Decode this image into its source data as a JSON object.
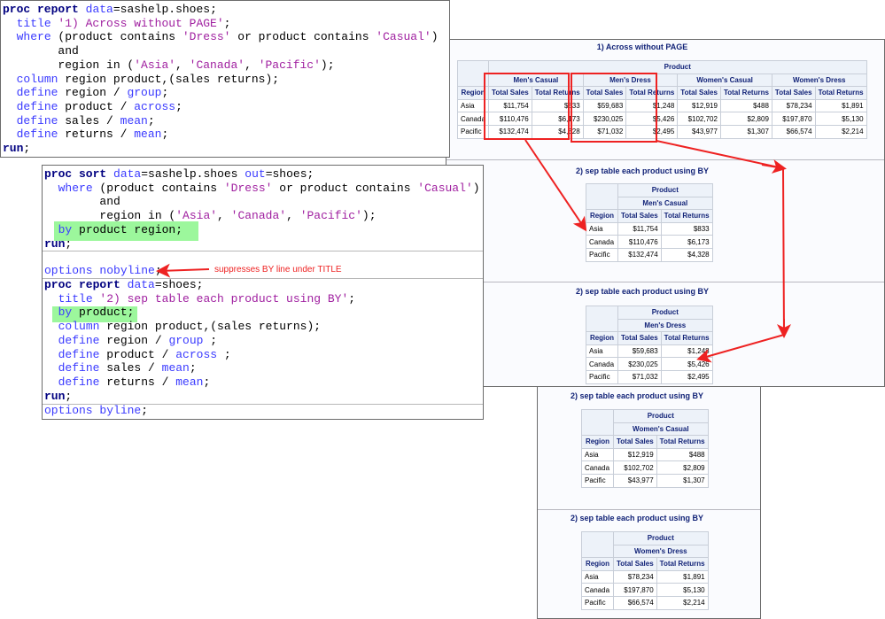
{
  "colors": {
    "keyword": "#000080",
    "statement": "#3a3aff",
    "string": "#a020a0",
    "header_text": "#112277",
    "header_bg": "#edf2f9",
    "annotation": "#ee2222",
    "highlight": "#9cf79c"
  },
  "code1": [
    [
      [
        "proc report",
        "kw"
      ],
      [
        " ",
        ""
      ],
      [
        "data",
        "bl"
      ],
      [
        "=sashelp.shoes;",
        ""
      ]
    ],
    [
      [
        "  ",
        ""
      ],
      [
        "title",
        "bl"
      ],
      [
        " '1) Across without PAGE'",
        "st"
      ],
      [
        ";",
        ""
      ]
    ],
    [
      [
        "  ",
        ""
      ],
      [
        "where",
        "bl"
      ],
      [
        " (product contains ",
        ""
      ],
      [
        "'Dress'",
        "st"
      ],
      [
        " or product contains ",
        ""
      ],
      [
        "'Casual'",
        "st"
      ],
      [
        ")",
        ""
      ]
    ],
    [
      [
        "        and",
        ""
      ]
    ],
    [
      [
        "        region in (",
        ""
      ],
      [
        "'Asia'",
        "st"
      ],
      [
        ", ",
        ""
      ],
      [
        "'Canada'",
        "st"
      ],
      [
        ", ",
        ""
      ],
      [
        "'Pacific'",
        "st"
      ],
      [
        ");",
        ""
      ]
    ],
    [
      [
        "  ",
        ""
      ],
      [
        "column",
        "bl"
      ],
      [
        " region product,(sales returns);",
        ""
      ]
    ],
    [
      [
        "  ",
        ""
      ],
      [
        "define",
        "bl"
      ],
      [
        " region / ",
        ""
      ],
      [
        "group",
        "bl"
      ],
      [
        ";",
        ""
      ]
    ],
    [
      [
        "  ",
        ""
      ],
      [
        "define",
        "bl"
      ],
      [
        " product / ",
        ""
      ],
      [
        "across",
        "bl"
      ],
      [
        ";",
        ""
      ]
    ],
    [
      [
        "  ",
        ""
      ],
      [
        "define",
        "bl"
      ],
      [
        " sales / ",
        ""
      ],
      [
        "mean",
        "bl"
      ],
      [
        ";",
        ""
      ]
    ],
    [
      [
        "  ",
        ""
      ],
      [
        "define",
        "bl"
      ],
      [
        " returns / ",
        ""
      ],
      [
        "mean",
        "bl"
      ],
      [
        ";",
        ""
      ]
    ],
    [
      [
        "run",
        "kw"
      ],
      [
        ";",
        ""
      ]
    ]
  ],
  "code2a": [
    [
      [
        "proc sort",
        "kw"
      ],
      [
        " ",
        ""
      ],
      [
        "data",
        "bl"
      ],
      [
        "=sashelp.shoes ",
        ""
      ],
      [
        "out",
        "bl"
      ],
      [
        "=shoes;",
        ""
      ]
    ],
    [
      [
        "  ",
        ""
      ],
      [
        "where",
        "bl"
      ],
      [
        " (product contains ",
        ""
      ],
      [
        "'Dress'",
        "st"
      ],
      [
        " or product contains ",
        ""
      ],
      [
        "'Casual'",
        "st"
      ],
      [
        ")",
        ""
      ]
    ],
    [
      [
        "        and",
        ""
      ]
    ],
    [
      [
        "        region in (",
        ""
      ],
      [
        "'Asia'",
        "st"
      ],
      [
        ", ",
        ""
      ],
      [
        "'Canada'",
        "st"
      ],
      [
        ", ",
        ""
      ],
      [
        "'Pacific'",
        "st"
      ],
      [
        ");",
        ""
      ]
    ],
    [
      [
        "  ",
        ""
      ],
      [
        "by",
        "bl"
      ],
      [
        " product region;",
        ""
      ]
    ],
    [
      [
        "run",
        "kw"
      ],
      [
        ";",
        ""
      ]
    ]
  ],
  "code2b": [
    [
      [
        "options",
        "bl"
      ],
      [
        " ",
        ""
      ],
      [
        "nobyline",
        "bl"
      ],
      [
        ";",
        ""
      ]
    ]
  ],
  "code2c": [
    [
      [
        "proc report",
        "kw"
      ],
      [
        " ",
        ""
      ],
      [
        "data",
        "bl"
      ],
      [
        "=shoes;",
        ""
      ]
    ],
    [
      [
        "  ",
        ""
      ],
      [
        "title",
        "bl"
      ],
      [
        " '2) sep table each product using BY'",
        "st"
      ],
      [
        ";",
        ""
      ]
    ],
    [
      [
        "  ",
        ""
      ],
      [
        "by",
        "bl"
      ],
      [
        " product;",
        ""
      ]
    ],
    [
      [
        "  ",
        ""
      ],
      [
        "column",
        "bl"
      ],
      [
        " region product,(sales returns);",
        ""
      ]
    ],
    [
      [
        "  ",
        ""
      ],
      [
        "define",
        "bl"
      ],
      [
        " region / ",
        ""
      ],
      [
        "group",
        "bl"
      ],
      [
        " ;",
        ""
      ]
    ],
    [
      [
        "  ",
        ""
      ],
      [
        "define",
        "bl"
      ],
      [
        " product / ",
        ""
      ],
      [
        "across",
        "bl"
      ],
      [
        " ;",
        ""
      ]
    ],
    [
      [
        "  ",
        ""
      ],
      [
        "define",
        "bl"
      ],
      [
        " sales / ",
        ""
      ],
      [
        "mean",
        "bl"
      ],
      [
        ";",
        ""
      ]
    ],
    [
      [
        "  ",
        ""
      ],
      [
        "define",
        "bl"
      ],
      [
        " returns / ",
        ""
      ],
      [
        "mean",
        "bl"
      ],
      [
        ";",
        ""
      ]
    ],
    [
      [
        "run",
        "kw"
      ],
      [
        ";",
        ""
      ]
    ]
  ],
  "code2d": [
    [
      [
        "options",
        "bl"
      ],
      [
        " ",
        ""
      ],
      [
        "byline",
        "bl"
      ],
      [
        ";",
        ""
      ]
    ]
  ],
  "annotation": "suppresses BY line under TITLE",
  "report1": {
    "title": "1) Across without PAGE",
    "product_label": "Product",
    "region_label": "Region",
    "sales_label": "Total Sales",
    "returns_label": "Total Returns",
    "products": [
      "Men's Casual",
      "Men's Dress",
      "Women's Casual",
      "Women's Dress"
    ],
    "rows": [
      {
        "region": "Asia",
        "values": [
          "$11,754",
          "$833",
          "$59,683",
          "$1,248",
          "$12,919",
          "$488",
          "$78,234",
          "$1,891"
        ]
      },
      {
        "region": "Canada",
        "values": [
          "$110,476",
          "$6,173",
          "$230,025",
          "$5,426",
          "$102,702",
          "$2,809",
          "$197,870",
          "$5,130"
        ]
      },
      {
        "region": "Pacific",
        "values": [
          "$132,474",
          "$4,328",
          "$71,032",
          "$2,495",
          "$43,977",
          "$1,307",
          "$66,574",
          "$2,214"
        ]
      }
    ]
  },
  "by_reports": [
    {
      "title": "2) sep table each product using BY",
      "product": "Men's Casual",
      "rows": [
        [
          "Asia",
          "$11,754",
          "$833"
        ],
        [
          "Canada",
          "$110,476",
          "$6,173"
        ],
        [
          "Pacific",
          "$132,474",
          "$4,328"
        ]
      ]
    },
    {
      "title": "2) sep table each product using BY",
      "product": "Men's Dress",
      "rows": [
        [
          "Asia",
          "$59,683",
          "$1,248"
        ],
        [
          "Canada",
          "$230,025",
          "$5,426"
        ],
        [
          "Pacific",
          "$71,032",
          "$2,495"
        ]
      ]
    },
    {
      "title": "2) sep table each product using BY",
      "product": "Women's Casual",
      "rows": [
        [
          "Asia",
          "$12,919",
          "$488"
        ],
        [
          "Canada",
          "$102,702",
          "$2,809"
        ],
        [
          "Pacific",
          "$43,977",
          "$1,307"
        ]
      ]
    },
    {
      "title": "2) sep table each product using BY",
      "product": "Women's Dress",
      "rows": [
        [
          "Asia",
          "$78,234",
          "$1,891"
        ],
        [
          "Canada",
          "$197,870",
          "$5,130"
        ],
        [
          "Pacific",
          "$66,574",
          "$2,214"
        ]
      ]
    }
  ]
}
